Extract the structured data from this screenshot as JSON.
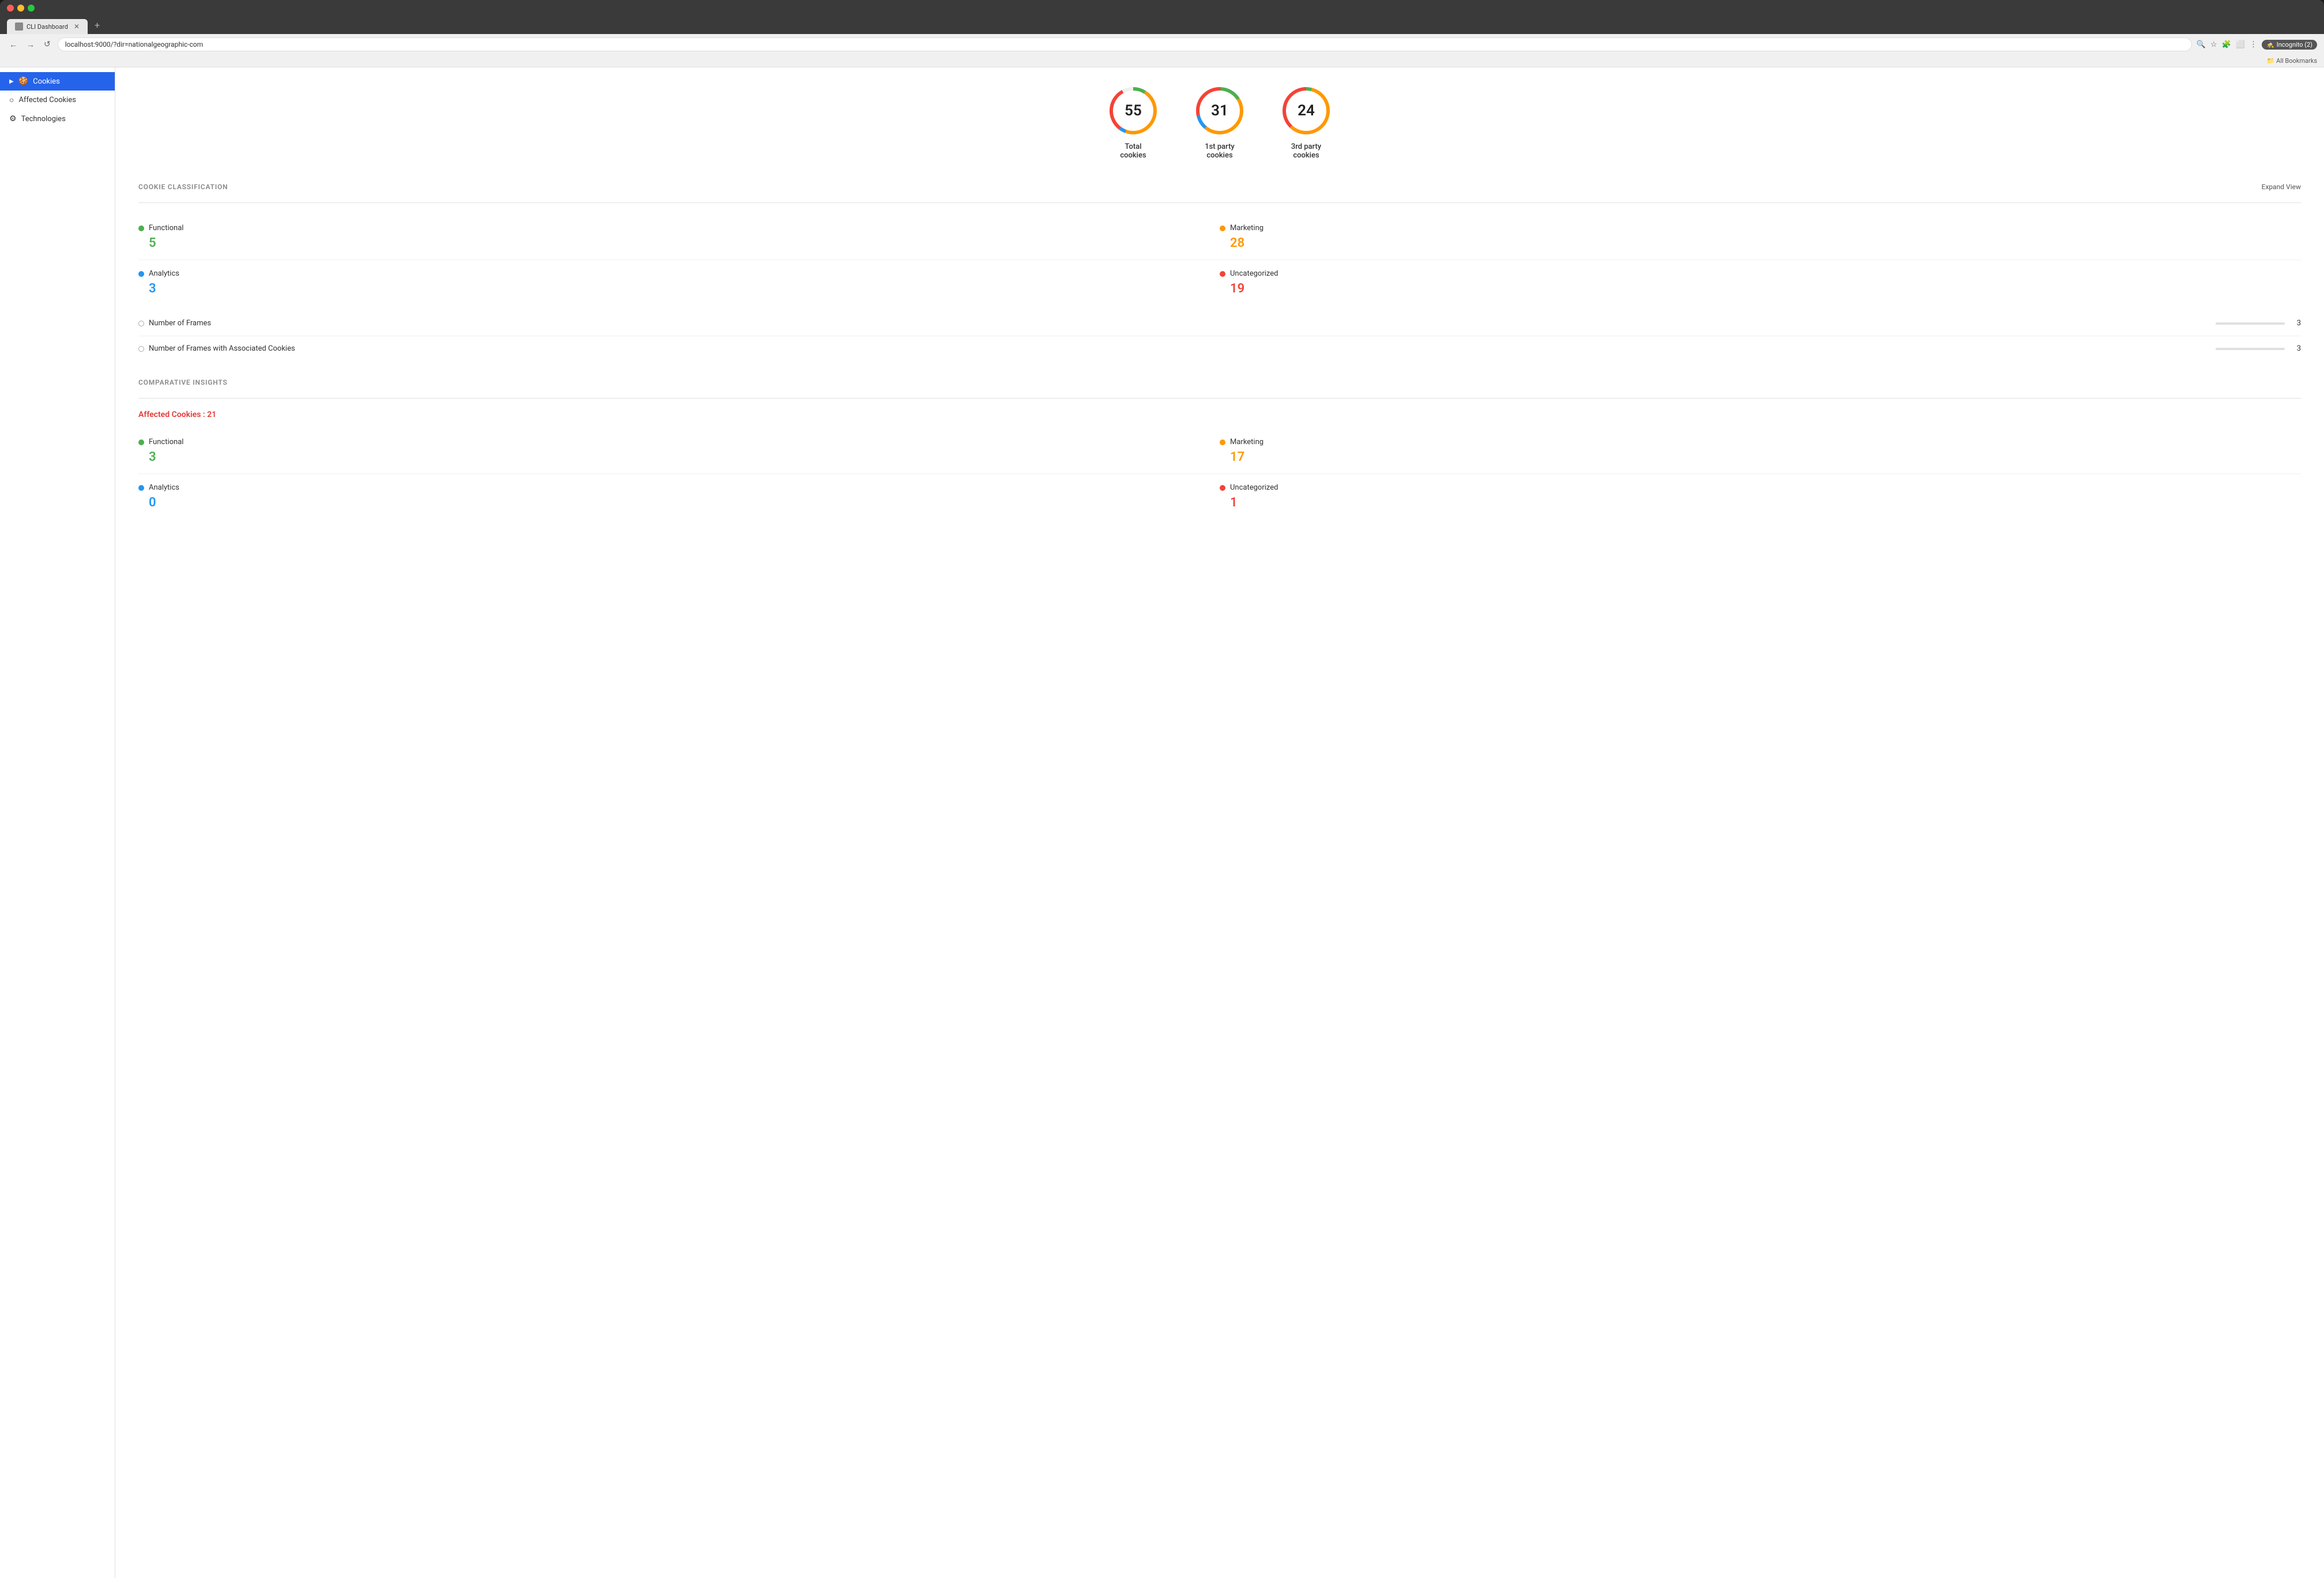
{
  "browser": {
    "tab_title": "CLI Dashboard",
    "url": "localhost:9000/?dir=nationalgeographic-com",
    "incognito_label": "Incognito (2)",
    "bookmarks_label": "All Bookmarks",
    "new_tab_symbol": "+"
  },
  "sidebar": {
    "items": [
      {
        "id": "cookies",
        "label": "Cookies",
        "icon": "🍪",
        "active": true
      },
      {
        "id": "affected-cookies",
        "label": "Affected Cookies",
        "icon": "○",
        "active": false
      },
      {
        "id": "technologies",
        "label": "Technologies",
        "icon": "⚙",
        "active": false
      }
    ]
  },
  "stats": {
    "total": {
      "number": "55",
      "label": "Total\ncookies"
    },
    "first_party": {
      "number": "31",
      "label": "1st party\ncookies"
    },
    "third_party": {
      "number": "24",
      "label": "3rd party\ncookies"
    }
  },
  "cookie_classification": {
    "section_title": "COOKIE CLASSIFICATION",
    "expand_label": "Expand View",
    "items": [
      {
        "name": "Functional",
        "value": "5",
        "color": "green",
        "dot_color": "green"
      },
      {
        "name": "Marketing",
        "value": "28",
        "color": "orange",
        "dot_color": "orange"
      },
      {
        "name": "Analytics",
        "value": "3",
        "color": "blue",
        "dot_color": "blue"
      },
      {
        "name": "Uncategorized",
        "value": "19",
        "color": "red",
        "dot_color": "red"
      }
    ],
    "frames": [
      {
        "label": "Number of Frames",
        "value": "3"
      },
      {
        "label": "Number of Frames with Associated Cookies",
        "value": "3"
      }
    ]
  },
  "comparative_insights": {
    "section_title": "COMPARATIVE INSIGHTS",
    "affected_label": "Affected Cookies : 21",
    "items": [
      {
        "name": "Functional",
        "value": "3",
        "color": "green",
        "dot_color": "green"
      },
      {
        "name": "Marketing",
        "value": "17",
        "color": "orange",
        "dot_color": "orange"
      },
      {
        "name": "Analytics",
        "value": "0",
        "color": "blue",
        "dot_color": "blue"
      },
      {
        "name": "Uncategorized",
        "value": "1",
        "color": "red",
        "dot_color": "red"
      }
    ]
  },
  "circles": {
    "total": {
      "segments": [
        {
          "color": "#4caf50",
          "pct": 9
        },
        {
          "color": "#ff9800",
          "pct": 51
        },
        {
          "color": "#2196f3",
          "pct": 5
        },
        {
          "color": "#f44336",
          "pct": 35
        }
      ]
    },
    "first_party": {
      "segments": [
        {
          "color": "#4caf50",
          "pct": 16
        },
        {
          "color": "#ff9800",
          "pct": 45
        },
        {
          "color": "#2196f3",
          "pct": 10
        },
        {
          "color": "#f44336",
          "pct": 29
        }
      ]
    },
    "third_party": {
      "segments": [
        {
          "color": "#4caf50",
          "pct": 4
        },
        {
          "color": "#ff9800",
          "pct": 58
        },
        {
          "color": "#2196f3",
          "pct": 0
        },
        {
          "color": "#f44336",
          "pct": 38
        }
      ]
    }
  }
}
